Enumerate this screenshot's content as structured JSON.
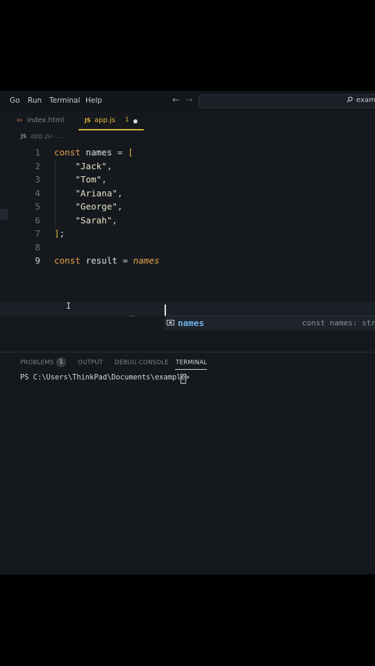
{
  "menu": {
    "items": [
      "Go",
      "Run",
      "Terminal",
      "Help"
    ],
    "search_text": "examp"
  },
  "tabs": [
    {
      "label": "index.html",
      "icon": "html-icon"
    },
    {
      "label": "app.js",
      "icon": "js-icon",
      "problems": "1",
      "active": true
    }
  ],
  "breadcrumb": {
    "badge": "JS",
    "file": "app.js",
    "more": "..."
  },
  "editor": {
    "lines": [
      {
        "n": "1",
        "parts": [
          [
            "kw",
            "const"
          ],
          [
            "punc",
            " "
          ],
          [
            "var",
            "names"
          ],
          [
            "punc",
            " = "
          ],
          [
            "brk",
            "["
          ]
        ]
      },
      {
        "n": "2",
        "parts": [
          [
            "punc",
            "    "
          ],
          [
            "str",
            "\"Jack\""
          ],
          [
            "punc",
            ","
          ]
        ]
      },
      {
        "n": "3",
        "parts": [
          [
            "punc",
            "    "
          ],
          [
            "str",
            "\"Tom\""
          ],
          [
            "punc",
            ","
          ]
        ]
      },
      {
        "n": "4",
        "parts": [
          [
            "punc",
            "    "
          ],
          [
            "str",
            "\"Ariana\""
          ],
          [
            "punc",
            ","
          ]
        ]
      },
      {
        "n": "5",
        "parts": [
          [
            "punc",
            "    "
          ],
          [
            "str",
            "\"George\""
          ],
          [
            "punc",
            ","
          ]
        ]
      },
      {
        "n": "6",
        "parts": [
          [
            "punc",
            "    "
          ],
          [
            "str",
            "\"Sarah\""
          ],
          [
            "punc",
            ","
          ]
        ]
      },
      {
        "n": "7",
        "parts": [
          [
            "brk",
            "]"
          ],
          [
            "punc",
            ";"
          ]
        ]
      },
      {
        "n": "8",
        "parts": []
      },
      {
        "n": "9",
        "parts": [
          [
            "kw",
            "const"
          ],
          [
            "punc",
            " "
          ],
          [
            "var",
            "result"
          ],
          [
            "punc",
            " = "
          ],
          [
            "italic-name",
            "names"
          ]
        ]
      }
    ]
  },
  "suggest": {
    "label": "names",
    "detail": "const names: str",
    "icon": "variable-icon"
  },
  "panel": {
    "tabs": [
      "PROBLEMS",
      "OUTPUT",
      "DEBUG CONSOLE",
      "TERMINAL"
    ],
    "problems_count": "1",
    "prompt": "PS C:\\Users\\ThinkPad\\Documents\\example> "
  },
  "colors": {
    "keyword": "#e8a24a",
    "accent": "#e0b43c",
    "suggest": "#6fb3e8",
    "background": "#15191e"
  }
}
